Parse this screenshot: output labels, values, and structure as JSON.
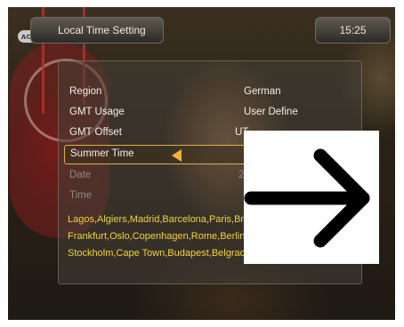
{
  "header": {
    "title": "Local Time Setting",
    "clock": "15:25"
  },
  "menu": {
    "items": [
      {
        "label": "Region",
        "value": "German"
      },
      {
        "label": "GMT Usage",
        "value": "User Define"
      },
      {
        "label": "GMT Offset",
        "value": "UT"
      },
      {
        "label": "Summer Time",
        "value": ""
      },
      {
        "label": "Date",
        "value": "2"
      },
      {
        "label": "Time",
        "value": ""
      }
    ]
  },
  "cities": {
    "line1": "Lagos,Algiers,Madrid,Barcelona,Paris,Brus",
    "line2": "Frankfurt,Oslo,Copenhagen,Rome,Berlin,Pr",
    "line3": "Stockholm,Cape Town,Budapest,Belgrade,"
  },
  "icons": {
    "logo": "receiver-logo-icon",
    "selector": "left-arrow-icon",
    "overlay": "right-arrow-icon"
  },
  "colors": {
    "highlight": "#d9b24a",
    "cities_text": "#f2d13a",
    "arrow_fill": "#f2b23a"
  }
}
